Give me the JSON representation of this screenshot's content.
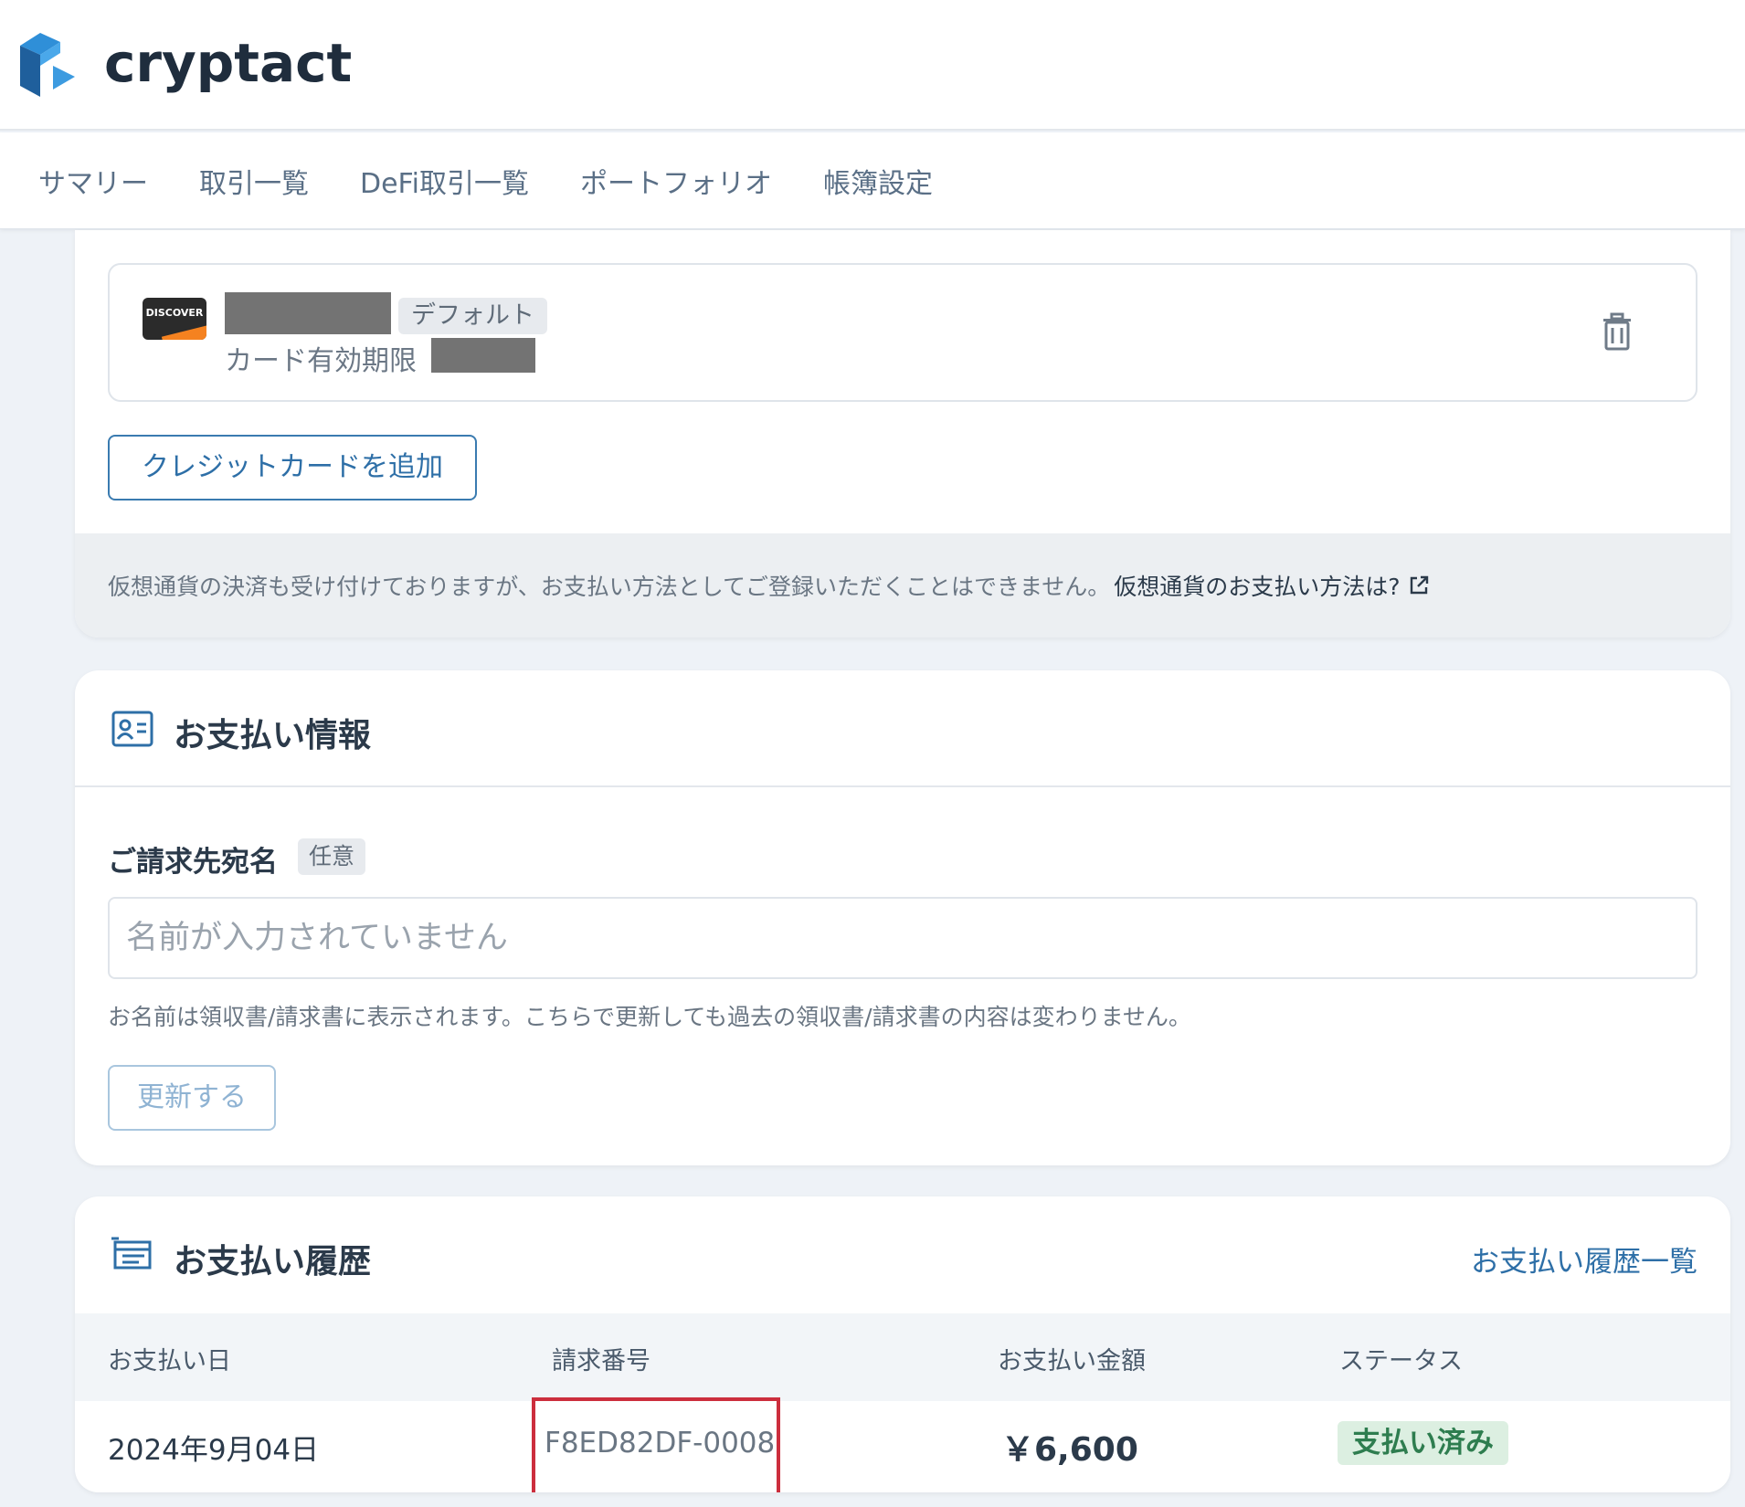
{
  "app": {
    "logo_text": "cryptact"
  },
  "nav": {
    "items": [
      {
        "label": "サマリー"
      },
      {
        "label": "取引一覧"
      },
      {
        "label": "DeFi取引一覧"
      },
      {
        "label": "ポートフォリオ"
      },
      {
        "label": "帳簿設定"
      }
    ]
  },
  "payment_methods": {
    "card": {
      "brand": "DISCOVER",
      "default_tag": "デフォルト",
      "expiry_label": "カード有効期限"
    },
    "add_card_button": "クレジットカードを追加",
    "notice_text": "仮想通貨の決済も受け付けておりますが、お支払い方法としてご登録いただくことはできません。",
    "notice_link": "仮想通貨のお支払い方法は?"
  },
  "payment_info": {
    "title": "お支払い情報",
    "billing_name_label": "ご請求先宛名",
    "optional_tag": "任意",
    "name_placeholder": "名前が入力されていません",
    "help_text": "お名前は領収書/請求書に表示されます。こちらで更新しても過去の領収書/請求書の内容は変わりません。",
    "update_button": "更新する"
  },
  "payment_history": {
    "title": "お支払い履歴",
    "list_link": "お支払い履歴一覧",
    "columns": [
      "お支払い日",
      "請求番号",
      "お支払い金額",
      "ステータス"
    ],
    "rows": [
      {
        "date": "2024年9月04日",
        "invoice": "F8ED82DF-0008",
        "amount": "￥6,600",
        "status": "支払い済み"
      }
    ]
  },
  "colors": {
    "accent": "#2e6fa7",
    "highlight_box": "#cc2e3d",
    "paid_badge_bg": "#dcefe1",
    "paid_badge_text": "#2e7d4f"
  }
}
